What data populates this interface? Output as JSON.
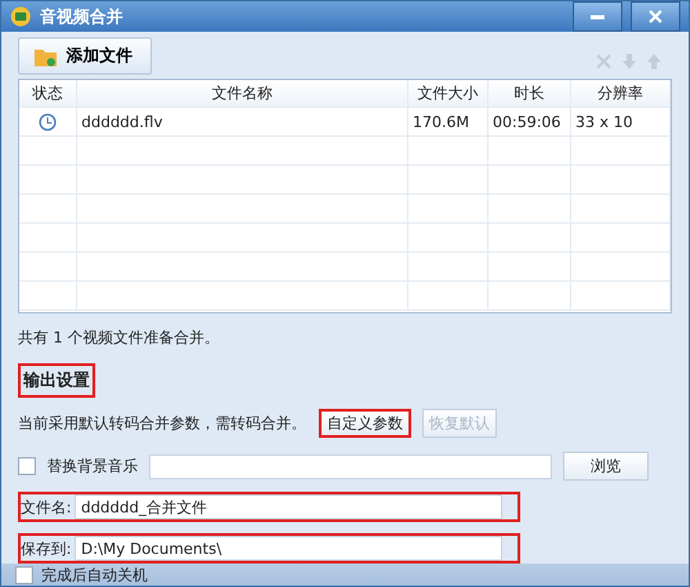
{
  "window": {
    "title": "音视频合并"
  },
  "toolbar": {
    "add_button": "添加文件"
  },
  "table": {
    "columns": [
      "状态",
      "文件名称",
      "文件大小",
      "时长",
      "分辨率"
    ],
    "rows": [
      {
        "name": "dddddd.flv",
        "size": "170.6M",
        "duration": "00:59:06",
        "resolution": "33 x 10"
      }
    ]
  },
  "summary": "共有 1 个视频文件准备合并。",
  "output": {
    "heading": "输出设置",
    "heading_highlighted": true,
    "note": "当前采用默认转码合并参数，需转码合并。",
    "buttons": [
      {
        "label": "自定义参数",
        "disabled": false,
        "highlighted": true
      },
      {
        "label": "恢复默认",
        "disabled": true,
        "highlighted": false
      }
    ],
    "music": {
      "label": "替换背景音乐",
      "checked": false,
      "browse": "浏览"
    },
    "fields": [
      {
        "label": "文件名:",
        "value": "dddddd_合并文件",
        "highlighted": true
      },
      {
        "label": "保存到:",
        "value": "D:\\My Documents\\",
        "highlighted": true
      }
    ]
  },
  "footer": {
    "shutdown": {
      "label": "完成后自动关机",
      "checked": false
    }
  }
}
